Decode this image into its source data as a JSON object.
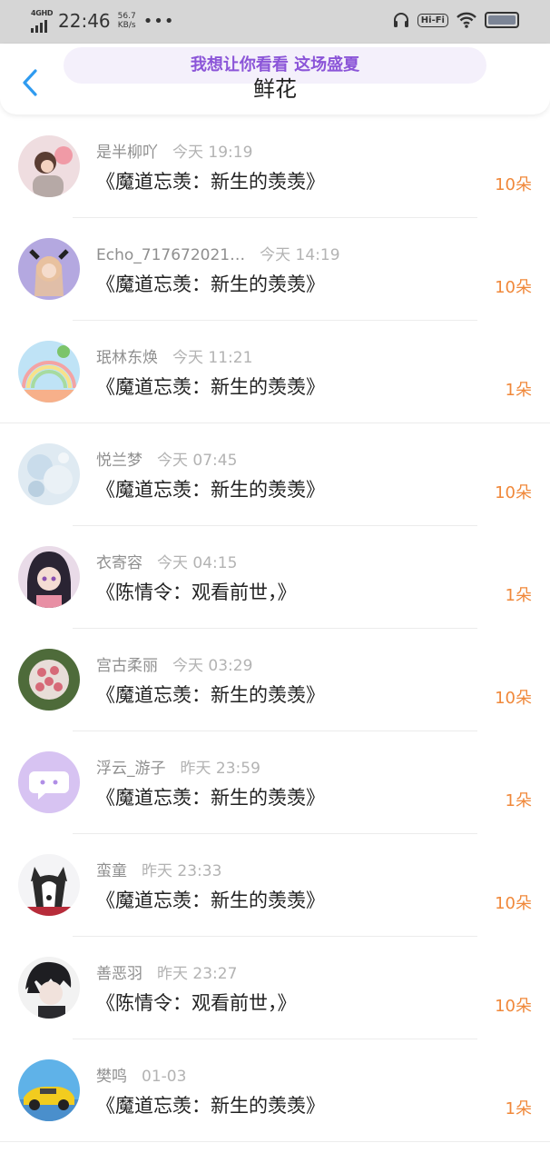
{
  "status_bar": {
    "network": "4GHD",
    "time": "22:46",
    "speed_value": "56.7",
    "speed_unit": "KB/s",
    "more": "•••",
    "hifi": "Hi-Fi"
  },
  "header": {
    "banner": "我想让你看看 这场盛夏",
    "title": "鲜花"
  },
  "colors": {
    "accent_orange": "#f0883a",
    "banner_purple": "#8b55d8"
  },
  "items": [
    {
      "name": "是半柳吖",
      "time": "今天 19:19",
      "work": "《魔道忘羡：新生的羡羡》",
      "count": "10朵",
      "avatar": "avatar-girl-pink"
    },
    {
      "name": "Echo_717672021…",
      "time": "今天 14:19",
      "work": "《魔道忘羡：新生的羡羡》",
      "count": "10朵",
      "avatar": "avatar-anime-girl-purple"
    },
    {
      "name": "珉林东焕",
      "time": "今天 11:21",
      "work": "《魔道忘羡：新生的羡羡》",
      "count": "1朵",
      "avatar": "avatar-rainbow-sky"
    },
    {
      "name": "悦兰梦",
      "time": "今天 07:45",
      "work": "《魔道忘羡：新生的羡羡》",
      "count": "10朵",
      "avatar": "avatar-pale-blue"
    },
    {
      "name": "衣寄容",
      "time": "今天 04:15",
      "work": "《陈情令：观看前世，》",
      "count": "1朵",
      "avatar": "avatar-anime-dark-hair"
    },
    {
      "name": "宫古柔丽",
      "time": "今天 03:29",
      "work": "《魔道忘羡：新生的羡羡》",
      "count": "10朵",
      "avatar": "avatar-flower-bouquet"
    },
    {
      "name": "浮云_游子",
      "time": "昨天 23:59",
      "work": "《魔道忘羡：新生的羡羡》",
      "count": "1朵",
      "avatar": "avatar-default-chat"
    },
    {
      "name": "蛮童",
      "time": "昨天 23:33",
      "work": "《魔道忘羡：新生的羡羡》",
      "count": "10朵",
      "avatar": "avatar-husky"
    },
    {
      "name": "善恶羽",
      "time": "昨天 23:27",
      "work": "《陈情令：观看前世，》",
      "count": "10朵",
      "avatar": "avatar-anime-boy"
    },
    {
      "name": "樊鸣",
      "time": "01-03",
      "work": "《魔道忘羡：新生的羡羡》",
      "count": "1朵",
      "avatar": "avatar-yellow-car"
    }
  ]
}
